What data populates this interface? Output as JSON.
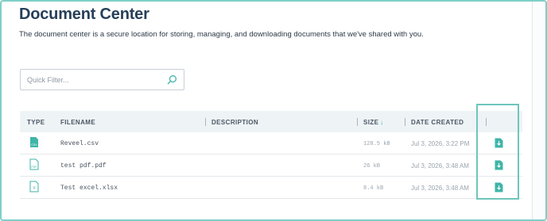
{
  "header": {
    "title": "Document Center",
    "subtitle": "The document center is a secure location for storing, managing, and downloading documents that we've shared with you."
  },
  "search": {
    "placeholder": "Quick Filter...",
    "icon": "search-icon"
  },
  "table": {
    "columns": {
      "type": "TYPE",
      "filename": "FILENAME",
      "description": "DESCRIPTION",
      "size": "SIZE",
      "date": "DATE CREATED"
    },
    "sort_indicator": "↓",
    "rows": [
      {
        "type_icon": "csv-file-icon",
        "type_label": "CSV",
        "filename": "Reveel.csv",
        "description": "",
        "size": "128.5 kB",
        "date": "Jul 3, 2026, 3:22 PM",
        "action_icon": "download-icon"
      },
      {
        "type_icon": "pdf-file-icon",
        "type_label": "PDF",
        "filename": "test pdf.pdf",
        "description": "",
        "size": "26 kB",
        "date": "Jul 3, 2026, 3:48 AM",
        "action_icon": "download-icon"
      },
      {
        "type_icon": "excel-file-icon",
        "type_label": "X",
        "filename": "Test excel.xlsx",
        "description": "",
        "size": "8.4 kB",
        "date": "Jul 3, 2026, 3:48 AM",
        "action_icon": "download-icon"
      }
    ]
  },
  "colors": {
    "accent": "#3fb5a8",
    "title": "#27405a",
    "highlight_border": "#6ec5bc",
    "header_bg": "#eef3f6"
  }
}
